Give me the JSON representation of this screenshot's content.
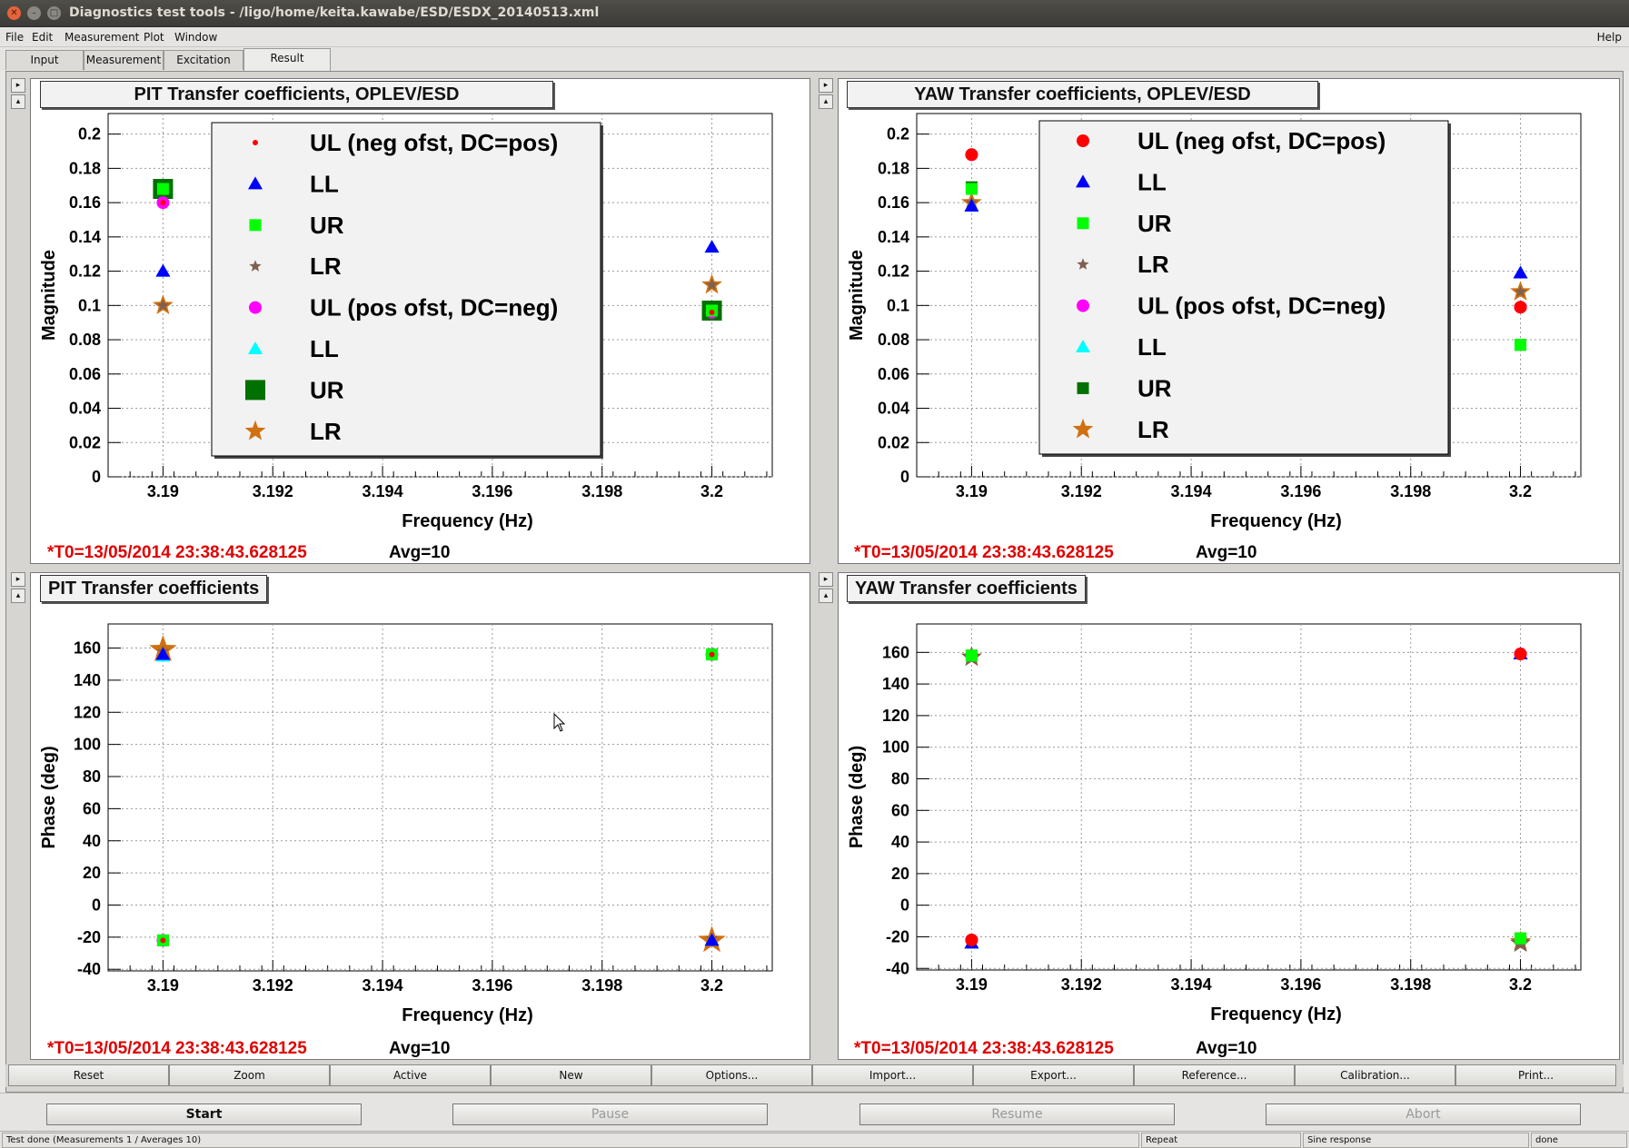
{
  "window": {
    "title": "Diagnostics test tools - /ligo/home/keita.kawabe/ESD/ESDX_20140513.xml"
  },
  "menu": {
    "file": "File",
    "edit": "Edit",
    "measurement": "Measurement",
    "plot": "Plot",
    "window": "Window",
    "help": "Help"
  },
  "tabs": [
    "Input",
    "Measurement",
    "Excitation",
    "Result"
  ],
  "panels": {
    "pit_mag": {
      "title": "PIT Transfer coefficients, OPLEV/ESD"
    },
    "yaw_mag": {
      "title": "YAW Transfer coefficients, OPLEV/ESD"
    },
    "pit_phase": {
      "title": "PIT Transfer coefficients"
    },
    "yaw_phase": {
      "title": "YAW Transfer coefficients"
    },
    "footer_t0": "*T0=13/05/2014 23:38:43.628125",
    "footer_avg": "Avg=10"
  },
  "colors": {
    "ul1": "#ff0000",
    "ll1": "#0000ff",
    "ur1": "#00ff00",
    "lr1": "#7f6050",
    "ul2": "#ff00ff",
    "ll2": "#00ffff",
    "ur2": "#007000",
    "lr2": "#d07010",
    "t0": "#e00000"
  },
  "chart_data": [
    {
      "type": "scatter",
      "title": "PIT Transfer coefficients, OPLEV/ESD",
      "xlabel": "Frequency (Hz)",
      "ylabel": "Magnitude",
      "y_exponent": "×10^-6",
      "xlim": [
        3.189,
        3.2011
      ],
      "ylim": [
        0,
        0.212
      ],
      "xticks": [
        "3.19",
        "3.192",
        "3.194",
        "3.196",
        "3.198",
        "3.2"
      ],
      "yticks": [
        "0",
        "0.02",
        "0.04",
        "0.06",
        "0.08",
        "0.1",
        "0.12",
        "0.14",
        "0.16",
        "0.18",
        "0.2"
      ],
      "grid": true,
      "legend": "upper-middle",
      "series": [
        {
          "name": "UL (neg ofst, DC=pos)",
          "key": "ul1",
          "marker": "dot",
          "x": [
            3.19,
            3.2
          ],
          "y": [
            0.16,
            0.096
          ]
        },
        {
          "name": "LL",
          "key": "ll1",
          "marker": "triangle",
          "x": [
            3.19,
            3.2
          ],
          "y": [
            0.12,
            0.134
          ]
        },
        {
          "name": "UR",
          "key": "ur1",
          "marker": "square",
          "x": [
            3.19,
            3.2
          ],
          "y": [
            0.168,
            0.097
          ]
        },
        {
          "name": "LR",
          "key": "lr1",
          "marker": "star-small",
          "x": [
            3.19,
            3.2
          ],
          "y": [
            0.1,
            0.112
          ]
        },
        {
          "name": "UL (pos ofst, DC=neg)",
          "key": "ul2",
          "marker": "circle",
          "x": [
            3.19,
            3.2
          ],
          "y": [
            0.16,
            0.096
          ]
        },
        {
          "name": "LL",
          "key": "ll2",
          "marker": "triangle",
          "x": [
            3.19,
            3.2
          ],
          "y": [
            0.12,
            0.134
          ]
        },
        {
          "name": "UR",
          "key": "ur2",
          "marker": "square-big",
          "x": [
            3.19,
            3.2
          ],
          "y": [
            0.168,
            0.097
          ]
        },
        {
          "name": "LR",
          "key": "lr2",
          "marker": "star",
          "x": [
            3.19,
            3.2
          ],
          "y": [
            0.1,
            0.112
          ]
        }
      ]
    },
    {
      "type": "scatter",
      "title": "YAW Transfer coefficients, OPLEV/ESD",
      "xlabel": "Frequency (Hz)",
      "ylabel": "Magnitude",
      "y_exponent": "×10^-6",
      "xlim": [
        3.189,
        3.2011
      ],
      "ylim": [
        0,
        0.212
      ],
      "xticks": [
        "3.19",
        "3.192",
        "3.194",
        "3.196",
        "3.198",
        "3.2"
      ],
      "yticks": [
        "0",
        "0.02",
        "0.04",
        "0.06",
        "0.08",
        "0.1",
        "0.12",
        "0.14",
        "0.16",
        "0.18",
        "0.2"
      ],
      "grid": true,
      "legend": "upper-middle",
      "series": [
        {
          "name": "UL (neg ofst, DC=pos)",
          "key": "ul1",
          "marker": "circle",
          "x": [
            3.19,
            3.2
          ],
          "y": [
            0.188,
            0.099
          ]
        },
        {
          "name": "LL",
          "key": "ll1",
          "marker": "triangle",
          "x": [
            3.19,
            3.2
          ],
          "y": [
            0.158,
            0.119
          ]
        },
        {
          "name": "UR",
          "key": "ur1",
          "marker": "square",
          "x": [
            3.19,
            3.2
          ],
          "y": [
            0.168,
            0.077
          ]
        },
        {
          "name": "LR",
          "key": "lr1",
          "marker": "star-small",
          "x": [
            3.19,
            3.2
          ],
          "y": [
            0.16,
            0.108
          ]
        },
        {
          "name": "UL  (pos ofst, DC=neg)",
          "key": "ul2",
          "marker": "circle",
          "x": [
            3.19,
            3.2
          ],
          "y": [
            0.188,
            0.099
          ]
        },
        {
          "name": "LL",
          "key": "ll2",
          "marker": "triangle",
          "x": [
            3.19,
            3.2
          ],
          "y": [
            0.158,
            0.119
          ]
        },
        {
          "name": "UR",
          "key": "ur2",
          "marker": "square",
          "x": [
            3.19,
            3.2
          ],
          "y": [
            0.169,
            0.077
          ]
        },
        {
          "name": "LR",
          "key": "lr2",
          "marker": "star",
          "x": [
            3.19,
            3.2
          ],
          "y": [
            0.16,
            0.108
          ]
        }
      ]
    },
    {
      "type": "scatter",
      "title": "PIT Transfer coefficients",
      "xlabel": "Frequency (Hz)",
      "ylabel": "Phase (deg)",
      "xlim": [
        3.189,
        3.2011
      ],
      "ylim": [
        -41,
        175
      ],
      "xticks": [
        "3.19",
        "3.192",
        "3.194",
        "3.196",
        "3.198",
        "3.2"
      ],
      "yticks": [
        "-40",
        "-20",
        "0",
        "20",
        "40",
        "60",
        "80",
        "100",
        "120",
        "140",
        "160"
      ],
      "grid": true,
      "legend": "none",
      "series": [
        {
          "name": "UL (neg ofst, DC=pos)",
          "key": "ul1",
          "marker": "dot",
          "x": [
            3.19,
            3.2
          ],
          "y": [
            -22,
            156
          ]
        },
        {
          "name": "LL",
          "key": "ll1",
          "marker": "triangle",
          "x": [
            3.19,
            3.2
          ],
          "y": [
            156,
            -22
          ]
        },
        {
          "name": "UR",
          "key": "ur1",
          "marker": "square",
          "x": [
            3.19,
            3.2
          ],
          "y": [
            -22,
            156
          ]
        },
        {
          "name": "LR",
          "key": "lr1",
          "marker": "star-small",
          "x": [
            3.19,
            3.2
          ],
          "y": [
            158,
            -21
          ]
        },
        {
          "name": "UL (pos ofst, DC=neg)",
          "key": "ul2",
          "marker": "circle",
          "x": [
            3.19,
            3.2
          ],
          "y": [
            -22,
            156
          ]
        },
        {
          "name": "LL",
          "key": "ll2",
          "marker": "triangle",
          "x": [
            3.19,
            3.2
          ],
          "y": [
            155,
            -22
          ]
        },
        {
          "name": "UR",
          "key": "ur2",
          "marker": "square",
          "x": [
            3.19,
            3.2
          ],
          "y": [
            -22,
            156
          ]
        },
        {
          "name": "LR",
          "key": "lr2",
          "marker": "star-big",
          "x": [
            3.19,
            3.2
          ],
          "y": [
            159,
            -22
          ]
        }
      ]
    },
    {
      "type": "scatter",
      "title": "YAW Transfer coefficients",
      "xlabel": "Frequency (Hz)",
      "ylabel": "Phase (deg)",
      "xlim": [
        3.189,
        3.2011
      ],
      "ylim": [
        -41,
        178
      ],
      "xticks": [
        "3.19",
        "3.192",
        "3.194",
        "3.196",
        "3.198",
        "3.2"
      ],
      "yticks": [
        "-40",
        "-20",
        "0",
        "20",
        "40",
        "60",
        "80",
        "100",
        "120",
        "140",
        "160"
      ],
      "grid": true,
      "legend": "none",
      "series": [
        {
          "name": "UL (neg ofst, DC=pos)",
          "key": "ul1",
          "marker": "circle",
          "x": [
            3.19,
            3.2
          ],
          "y": [
            -22,
            159
          ]
        },
        {
          "name": "LL",
          "key": "ll1",
          "marker": "triangle",
          "x": [
            3.19,
            3.2
          ],
          "y": [
            -24,
            159
          ]
        },
        {
          "name": "UR",
          "key": "ur1",
          "marker": "square",
          "x": [
            3.19,
            3.2
          ],
          "y": [
            158,
            -21
          ]
        },
        {
          "name": "LR",
          "key": "lr1",
          "marker": "star",
          "x": [
            3.19,
            3.2
          ],
          "y": [
            157,
            -24
          ]
        },
        {
          "name": "UL  (pos ofst, DC=neg)",
          "key": "ul2",
          "marker": "circle",
          "x": [
            3.19,
            3.2
          ],
          "y": [
            -22,
            159
          ]
        },
        {
          "name": "LL",
          "key": "ll2",
          "marker": "triangle",
          "x": [
            3.19,
            3.2
          ],
          "y": [
            -24,
            159
          ]
        },
        {
          "name": "UR",
          "key": "ur2",
          "marker": "square",
          "x": [
            3.19,
            3.2
          ],
          "y": [
            158,
            -21
          ]
        },
        {
          "name": "LR",
          "key": "lr2",
          "marker": "star",
          "x": [
            3.19,
            3.2
          ],
          "y": [
            157,
            -23
          ]
        }
      ]
    }
  ],
  "panel_buttons": [
    "Reset",
    "Zoom",
    "Active",
    "New",
    "Options...",
    "Import...",
    "Export...",
    "Reference...",
    "Calibration...",
    "Print..."
  ],
  "controls": {
    "start": "Start",
    "pause": "Pause",
    "resume": "Resume",
    "abort": "Abort"
  },
  "status": {
    "message": "Test done (Measurements 1 / Averages 10)",
    "repeat": "Repeat",
    "type": "Sine response",
    "state": "done"
  }
}
